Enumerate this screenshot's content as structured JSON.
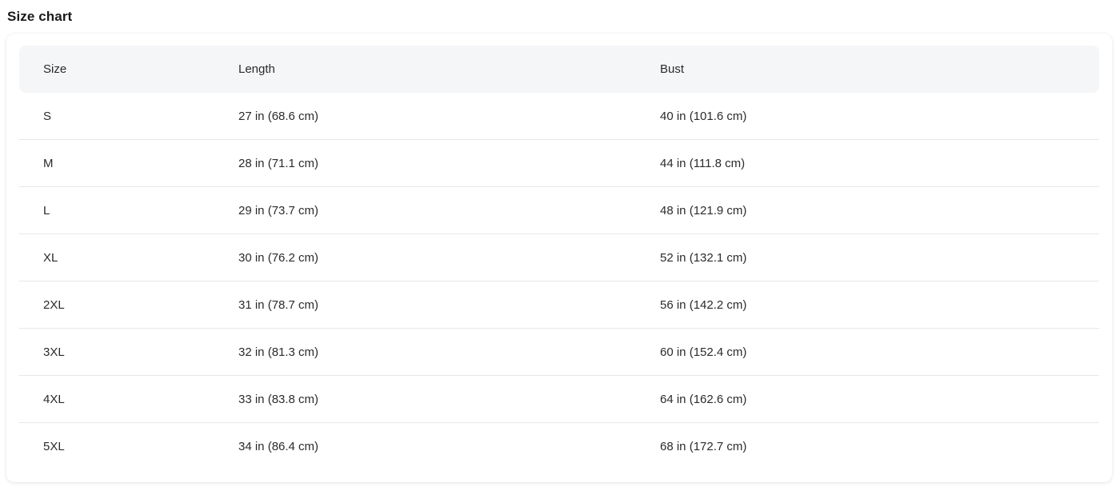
{
  "title": "Size chart",
  "table": {
    "headers": [
      "Size",
      "Length",
      "Bust"
    ],
    "rows": [
      [
        "S",
        "27 in  (68.6 cm)",
        "40 in  (101.6 cm)"
      ],
      [
        "M",
        "28 in  (71.1 cm)",
        "44 in  (111.8 cm)"
      ],
      [
        "L",
        "29 in  (73.7 cm)",
        "48 in  (121.9 cm)"
      ],
      [
        "XL",
        "30 in  (76.2 cm)",
        "52 in  (132.1 cm)"
      ],
      [
        "2XL",
        "31 in  (78.7 cm)",
        "56 in  (142.2 cm)"
      ],
      [
        "3XL",
        "32 in  (81.3 cm)",
        "60 in  (152.4 cm)"
      ],
      [
        "4XL",
        "33 in  (83.8 cm)",
        "64 in  (162.6 cm)"
      ],
      [
        "5XL",
        "34 in  (86.4 cm)",
        "68 in  (172.7 cm)"
      ]
    ]
  }
}
